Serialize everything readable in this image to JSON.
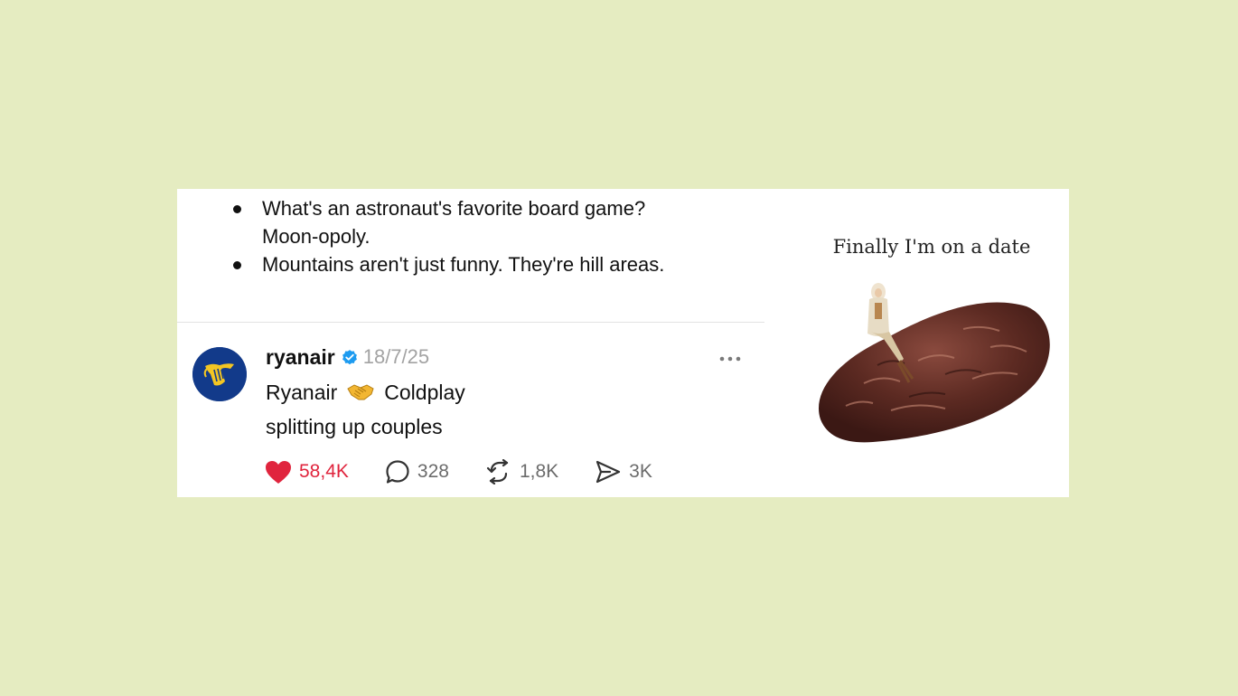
{
  "jokes": {
    "items": [
      {
        "text_line1": "What's an astronaut's favorite board game?",
        "text_line2": "Moon-opoly."
      },
      {
        "text_line1": "Mountains aren't just funny. They're hill areas."
      }
    ]
  },
  "tweet": {
    "username": "ryanair",
    "date": "18/7/25",
    "body_line1_before": "Ryanair",
    "body_line1_after": "Coldplay",
    "body_line2": "splitting up couples",
    "stats": {
      "likes": "58,4K",
      "replies": "328",
      "reposts": "1,8K",
      "shares": "3K"
    },
    "colors": {
      "like": "#e0243d",
      "verified": "#1d9bf0",
      "avatar_bg": "#123a8a",
      "avatar_logo": "#f3c623"
    },
    "icons": [
      "verified-badge-icon",
      "more-options-icon",
      "heart-icon",
      "reply-icon",
      "repost-icon",
      "share-icon",
      "handshake-icon"
    ]
  },
  "meme": {
    "caption": "Finally I'm on a date"
  }
}
